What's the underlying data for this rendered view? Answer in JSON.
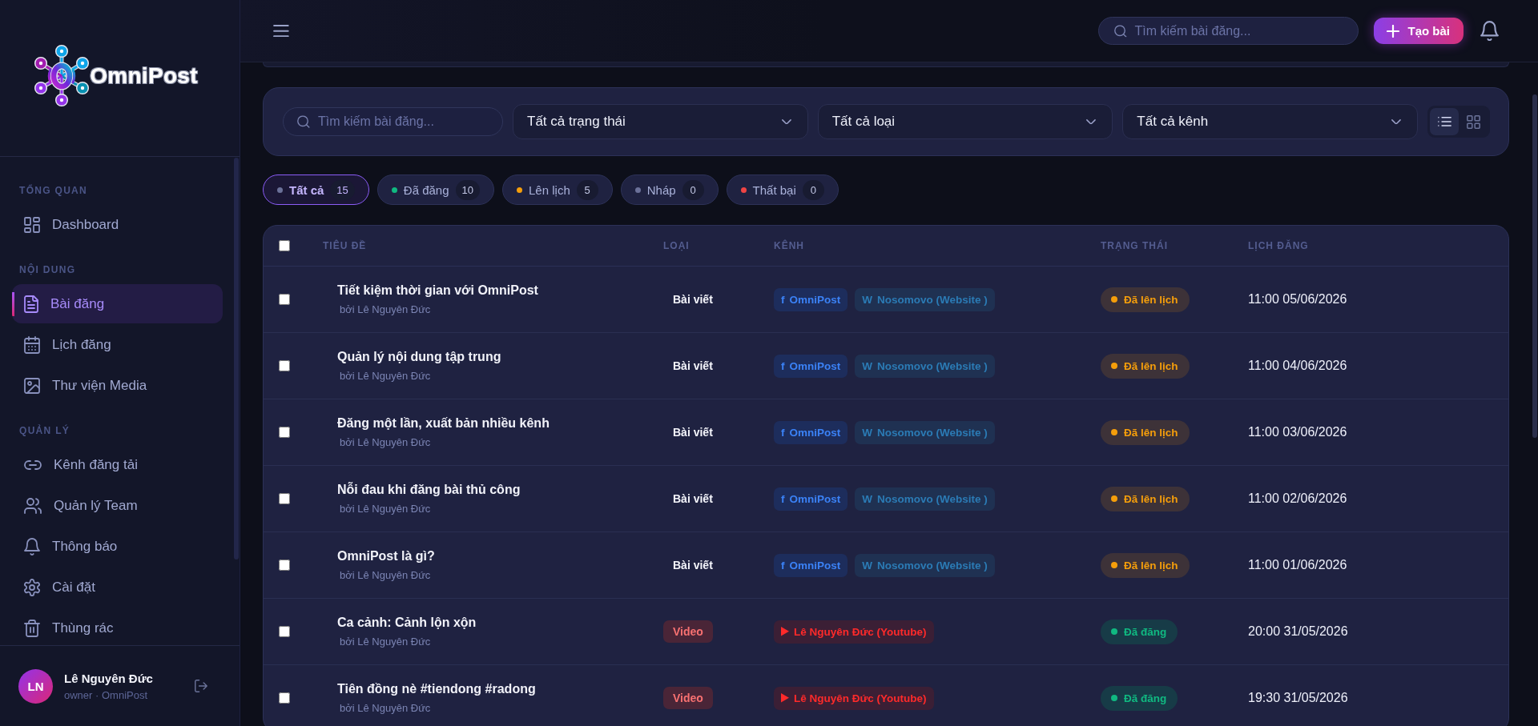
{
  "sidebar": {
    "logo": {
      "text": "OmniPost"
    },
    "sections": [
      {
        "title": "TỔNG QUAN",
        "items": [
          {
            "kind": "dashboard",
            "label": "Dashboard",
            "selected": false
          }
        ]
      },
      {
        "title": "NỘI DUNG",
        "items": [
          {
            "kind": "posts",
            "label": "Bài đăng",
            "selected": true
          },
          {
            "kind": "calendar",
            "label": "Lịch đăng",
            "selected": false
          },
          {
            "kind": "media",
            "label": "Thư viện Media",
            "selected": false
          }
        ]
      },
      {
        "title": "QUẢN LÝ",
        "items": [
          {
            "kind": "link",
            "label": "Kênh đăng tải",
            "selected": false
          },
          {
            "kind": "team",
            "label": "Quản lý Team",
            "selected": false
          },
          {
            "kind": "bell",
            "label": "Thông báo",
            "selected": false
          },
          {
            "kind": "settings",
            "label": "Cài đặt",
            "selected": false
          },
          {
            "kind": "trash",
            "label": "Thùng rác",
            "selected": false
          }
        ]
      }
    ],
    "user": {
      "initials": "LN",
      "name": "Lê Nguyên Đức",
      "role": "owner · OmniPost"
    }
  },
  "topbar": {
    "search": {
      "placeholder": "Tìm kiếm bài đăng..."
    },
    "create_button": {
      "label": "Tạo bài"
    }
  },
  "filters": {
    "search": {
      "placeholder": "Tìm kiếm bài đăng..."
    },
    "selects": [
      {
        "value": "Tất cả trạng thái"
      },
      {
        "value": "Tất cả loại"
      },
      {
        "value": "Tất cả kênh"
      }
    ],
    "views": [
      {
        "kind": "list",
        "selected": true
      },
      {
        "kind": "grid",
        "selected": false
      }
    ]
  },
  "status_tabs": [
    {
      "label": "Tất cả",
      "count": "15",
      "color": "#6b7199",
      "selected": true
    },
    {
      "label": "Đã đăng",
      "count": "10",
      "color": "#10b981",
      "selected": false
    },
    {
      "label": "Lên lịch",
      "count": "5",
      "color": "#f59e0b",
      "selected": false
    },
    {
      "label": "Nháp",
      "count": "0",
      "color": "#6b7199",
      "selected": false
    },
    {
      "label": "Thất bại",
      "count": "0",
      "color": "#ef4444",
      "selected": false
    }
  ],
  "table": {
    "select_all": {
      "checked": false
    },
    "columns": [
      "TIÊU ĐỀ",
      "LOẠI",
      "KÊNH",
      "TRẠNG THÁI",
      "LỊCH ĐĂNG"
    ],
    "rows": [
      {
        "checked": false,
        "title": "Tiết kiệm thời gian với OmniPost",
        "author": "bởi Lê Nguyên Đức",
        "type": {
          "kind": "article",
          "label": "Bài viết"
        },
        "channels": [
          {
            "kind": "facebook",
            "mark": "f",
            "label": "OmniPost"
          },
          {
            "kind": "website",
            "mark": "W",
            "label": "Nosomovo (Website )"
          }
        ],
        "status": {
          "kind": "scheduled",
          "label": "Đã lên lịch"
        },
        "schedule": "11:00 05/06/2026"
      },
      {
        "checked": false,
        "title": "Quản lý nội dung tập trung",
        "author": "bởi Lê Nguyên Đức",
        "type": {
          "kind": "article",
          "label": "Bài viết"
        },
        "channels": [
          {
            "kind": "facebook",
            "mark": "f",
            "label": "OmniPost"
          },
          {
            "kind": "website",
            "mark": "W",
            "label": "Nosomovo (Website )"
          }
        ],
        "status": {
          "kind": "scheduled",
          "label": "Đã lên lịch"
        },
        "schedule": "11:00 04/06/2026"
      },
      {
        "checked": false,
        "title": "Đăng một lần, xuất bản nhiều kênh",
        "author": "bởi Lê Nguyên Đức",
        "type": {
          "kind": "article",
          "label": "Bài viết"
        },
        "channels": [
          {
            "kind": "facebook",
            "mark": "f",
            "label": "OmniPost"
          },
          {
            "kind": "website",
            "mark": "W",
            "label": "Nosomovo (Website )"
          }
        ],
        "status": {
          "kind": "scheduled",
          "label": "Đã lên lịch"
        },
        "schedule": "11:00 03/06/2026"
      },
      {
        "checked": false,
        "title": "Nỗi đau khi đăng bài thủ công",
        "author": "bởi Lê Nguyên Đức",
        "type": {
          "kind": "article",
          "label": "Bài viết"
        },
        "channels": [
          {
            "kind": "facebook",
            "mark": "f",
            "label": "OmniPost"
          },
          {
            "kind": "website",
            "mark": "W",
            "label": "Nosomovo (Website )"
          }
        ],
        "status": {
          "kind": "scheduled",
          "label": "Đã lên lịch"
        },
        "schedule": "11:00 02/06/2026"
      },
      {
        "checked": false,
        "title": "OmniPost là gì?",
        "author": "bởi Lê Nguyên Đức",
        "type": {
          "kind": "article",
          "label": "Bài viết"
        },
        "channels": [
          {
            "kind": "facebook",
            "mark": "f",
            "label": "OmniPost"
          },
          {
            "kind": "website",
            "mark": "W",
            "label": "Nosomovo (Website )"
          }
        ],
        "status": {
          "kind": "scheduled",
          "label": "Đã lên lịch"
        },
        "schedule": "11:00 01/06/2026"
      },
      {
        "checked": false,
        "title": "Ca cảnh: Cảnh lộn xộn",
        "author": "bởi Lê Nguyên Đức",
        "type": {
          "kind": "video",
          "label": "Video"
        },
        "channels": [
          {
            "kind": "youtube",
            "label": "Lê Nguyên Đức (Youtube)"
          }
        ],
        "status": {
          "kind": "published",
          "label": "Đã đăng"
        },
        "schedule": "20:00 31/05/2026"
      },
      {
        "checked": false,
        "title": "Tiên đồng nè #tiendong #radong",
        "author": "bởi Lê Nguyên Đức",
        "type": {
          "kind": "video",
          "label": "Video"
        },
        "channels": [
          {
            "kind": "youtube",
            "label": "Lê Nguyên Đức (Youtube)"
          }
        ],
        "status": {
          "kind": "published",
          "label": "Đã đăng"
        },
        "schedule": "19:30 31/05/2026"
      }
    ]
  }
}
